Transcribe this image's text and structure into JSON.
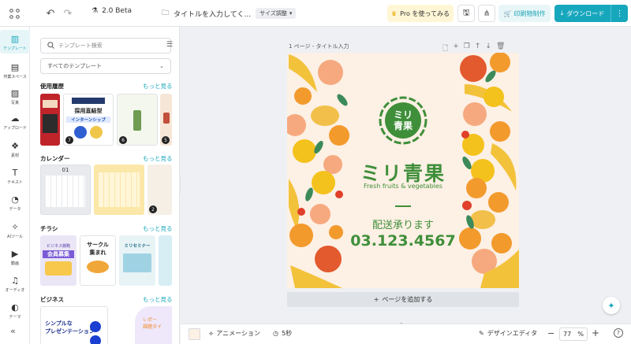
{
  "topbar": {
    "version": "2.0 Beta",
    "doc_title": "タイトルを入力してく...",
    "size_button": "サイズ調整",
    "pro_button": "Pro を使ってみる",
    "print_button": "印刷物制作",
    "download_button": "ダウンロード"
  },
  "rail": {
    "items": [
      {
        "label": "テンプレート",
        "icon": "template-icon"
      },
      {
        "label": "作業スペース",
        "icon": "workspace-icon"
      },
      {
        "label": "写真",
        "icon": "photo-icon"
      },
      {
        "label": "アップロード",
        "icon": "upload-icon"
      },
      {
        "label": "素材",
        "icon": "elements-icon"
      },
      {
        "label": "テキスト",
        "icon": "text-icon"
      },
      {
        "label": "データ",
        "icon": "data-icon"
      },
      {
        "label": "AIツール",
        "icon": "ai-icon"
      },
      {
        "label": "動画",
        "icon": "video-icon"
      },
      {
        "label": "オーディオ",
        "icon": "audio-icon"
      },
      {
        "label": "テーマ",
        "icon": "theme-icon"
      }
    ]
  },
  "panel": {
    "search_placeholder": "テンプレート検索",
    "select_value": "すべてのテンプレート",
    "more_label": "もっと見る",
    "sections": [
      {
        "title": "使用履歴"
      },
      {
        "title": "カレンダー"
      },
      {
        "title": "チラシ"
      },
      {
        "title": "ビジネス"
      }
    ],
    "history_thumbs": {
      "t2_title": "採用直結型",
      "t2_subtitle": "インターンシップ",
      "badges": [
        "7",
        "6",
        "5"
      ]
    },
    "calendar_badge": "2",
    "calendar_month": "01",
    "flyers": {
      "f1_line1": "ビジネス戦略",
      "f1_line2": "会員募集",
      "f2_line1": "サークル",
      "f2_line2": "集まれ",
      "f3_line1": "ミリセミナー"
    },
    "business": {
      "b1_line1": "シンプルな",
      "b1_line2": "プレゼンテーション",
      "b2_line1": "レポー",
      "b2_line2": "課題タイ"
    }
  },
  "canvas": {
    "page_label": "1 ページ - タイトル入力",
    "add_page": "ページを追加する",
    "design": {
      "logo_line1": "ミリ",
      "logo_line2": "青果",
      "brand": "ミリ青果",
      "tagline": "Fresh fruits & vegetables",
      "delivery": "配送承ります",
      "phone": "03.123.4567",
      "brand_color": "#3f8f3a",
      "bg_color": "#fdf0e4"
    }
  },
  "bottombar": {
    "animation": "アニメーション",
    "duration": "5秒",
    "design_editor": "デザインエディタ",
    "zoom_value": "77",
    "zoom_unit": "%"
  },
  "colors": {
    "accent": "#17a7bd"
  }
}
